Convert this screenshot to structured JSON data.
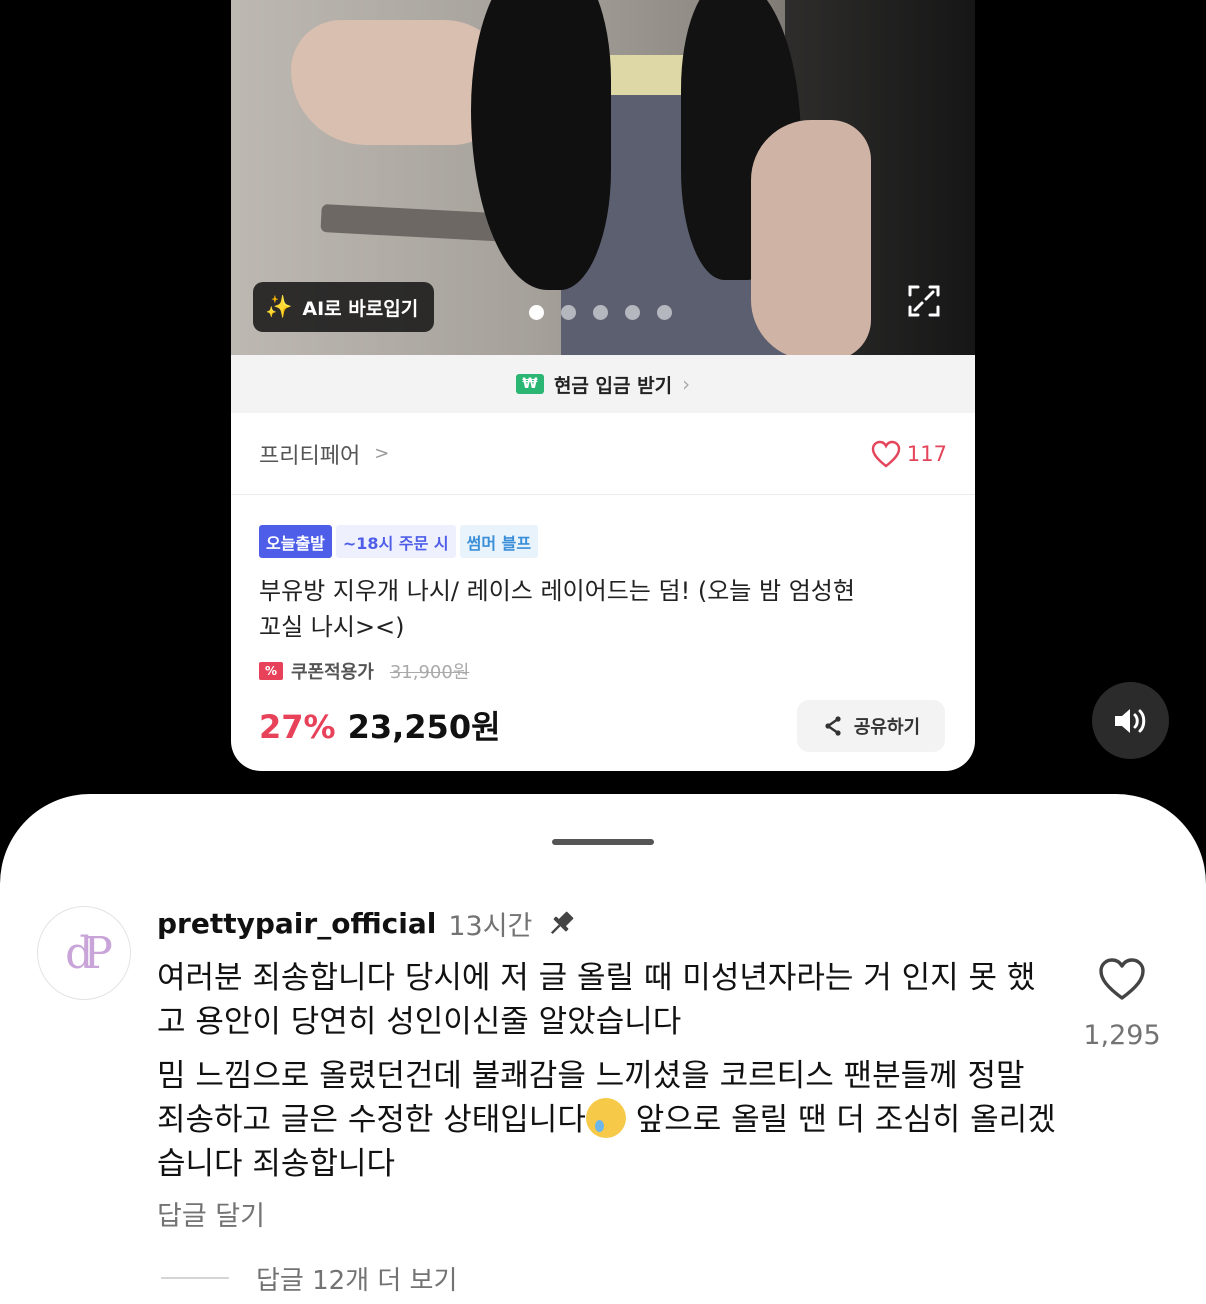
{
  "product": {
    "ai_try_on_label": "AI로 바로입기",
    "carousel": {
      "count": 5,
      "active_index": 0
    },
    "cash_bar": {
      "icon": "won-icon",
      "icon_text": "₩",
      "label": "현금 입금 받기"
    },
    "store": {
      "name": "프리티페어",
      "likes": "117"
    },
    "tags": [
      "오늘출발",
      "~18시 주문 시",
      "썸머 블프"
    ],
    "title_line1": "부유방 지우개 나시/ 레이스 레이어드는 덤! (오늘 밤 엄성현",
    "title_line2": "꼬실 나시><)",
    "coupon": {
      "label": "쿠폰적용가",
      "original_price": "31,900원"
    },
    "discount": "27%",
    "price": "23,250원",
    "share_label": "공유하기"
  },
  "comment": {
    "username": "prettypair_official",
    "time": "13시간",
    "avatar_text": "dP",
    "body_p1": "여러분 죄송합니다 당시에 저 글 올릴 때 미성년자라는 거 인지 못 했고 용안이 당연히 성인이신줄 알았습니다",
    "body_p2_a": "밈 느낌으로 올렸던건데 불쾌감을 느끼셨을 코르티스 팬분들께 정말 죄송하고 글은 수정한 상태입니다",
    "body_p2_b": " 앞으로 올릴 땐 더 조심히 올리겠습니다 죄송합니다",
    "like_count": "1,295",
    "reply_label": "답글 달기",
    "more_replies": "답글 12개 더 보기"
  },
  "colors": {
    "accent_red": "#e8425a",
    "tag_blue": "#4f5ee8",
    "cash_green": "#2bb673"
  }
}
